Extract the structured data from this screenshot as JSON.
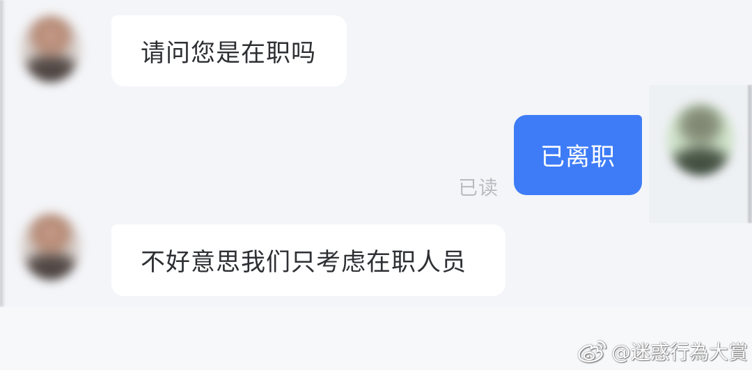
{
  "conversation": {
    "messages": [
      {
        "sender": "other",
        "text": "请问您是在职吗"
      },
      {
        "sender": "self",
        "text": "已离职",
        "status": "已读"
      },
      {
        "sender": "other",
        "text": "不好意思我们只考虑在职人员"
      }
    ]
  },
  "watermark": {
    "icon": "weibo-icon",
    "text": "@迷惑行為大賞"
  },
  "colors": {
    "outgoing_bubble": "#3e7cf7",
    "incoming_bubble": "#ffffff",
    "background": "#f4f5f8",
    "read_status": "#b9bcc2"
  }
}
